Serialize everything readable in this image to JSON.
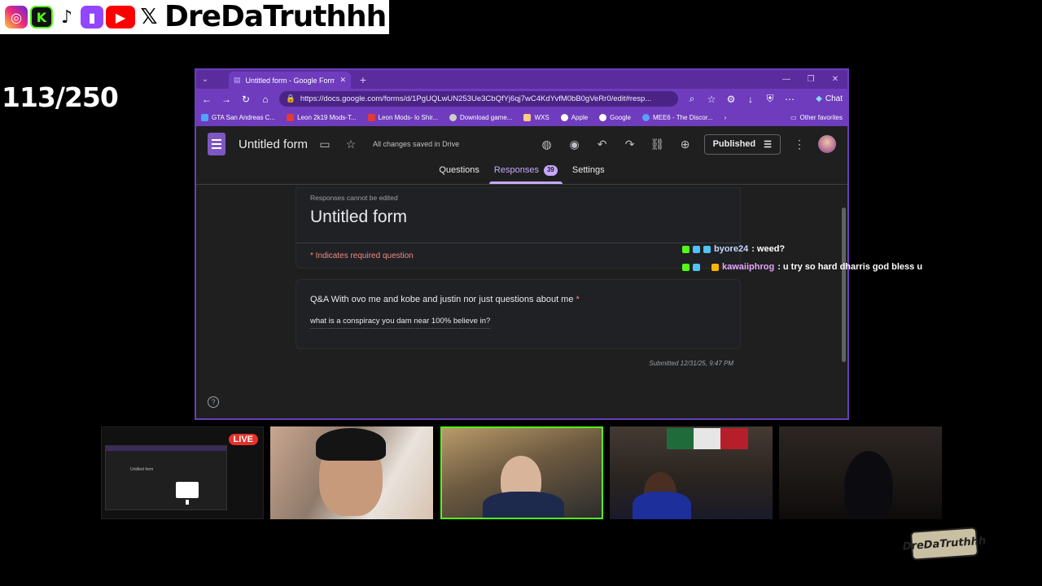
{
  "overlay": {
    "handle": "DreDaTruthhh",
    "counter": "113/250",
    "socials": [
      "instagram-icon",
      "kick-icon",
      "tiktok-icon",
      "twitch-icon",
      "youtube-icon",
      "x-icon"
    ]
  },
  "browser": {
    "tab_title": "Untitled form - Google Forms",
    "url": "https://docs.google.com/forms/d/1PgUQLwUN253Ue3CbQfYj6qj7wC4KdYvfM0bB0gVeRr0/edit#resp...",
    "chat_label": "Chat",
    "bookmarks": [
      "GTA San Andreas C...",
      "Leon 2k19 Mods-T...",
      "Leon Mods- lo Shir...",
      "Download game...",
      "WXS",
      "Apple",
      "Google",
      "MEE6 - The Discor..."
    ],
    "other_favorites": "Other favorites"
  },
  "form": {
    "title": "Untitled form",
    "saved": "All changes saved in Drive",
    "published": "Published",
    "tabs": {
      "questions": "Questions",
      "responses": "Responses",
      "responses_count": "39",
      "settings": "Settings"
    },
    "not_editable": "Responses cannot be edited",
    "card_title": "Untitled form",
    "required_note": "* Indicates required question",
    "question": "Q&A With ovo me and kobe and justin nor just questions about me",
    "question_star": "*",
    "answer": "what is a conspiracy you dam near 100% believe in?",
    "submitted": "Submitted 12/31/25, 9:47 PM",
    "help": "?"
  },
  "chat": [
    {
      "user": "byore24",
      "message": " : weed?"
    },
    {
      "user": "kawaiiphrog",
      "message": " : u try so hard dharris god bless u"
    }
  ],
  "cams": {
    "live": "LIVE",
    "mini_title": "Untitled form"
  },
  "logo": "DreDaTruthhh",
  "colors": {
    "accent": "#6e3cbc",
    "kick": "#53fc18",
    "live": "#e5322c",
    "required": "#f28b82"
  }
}
